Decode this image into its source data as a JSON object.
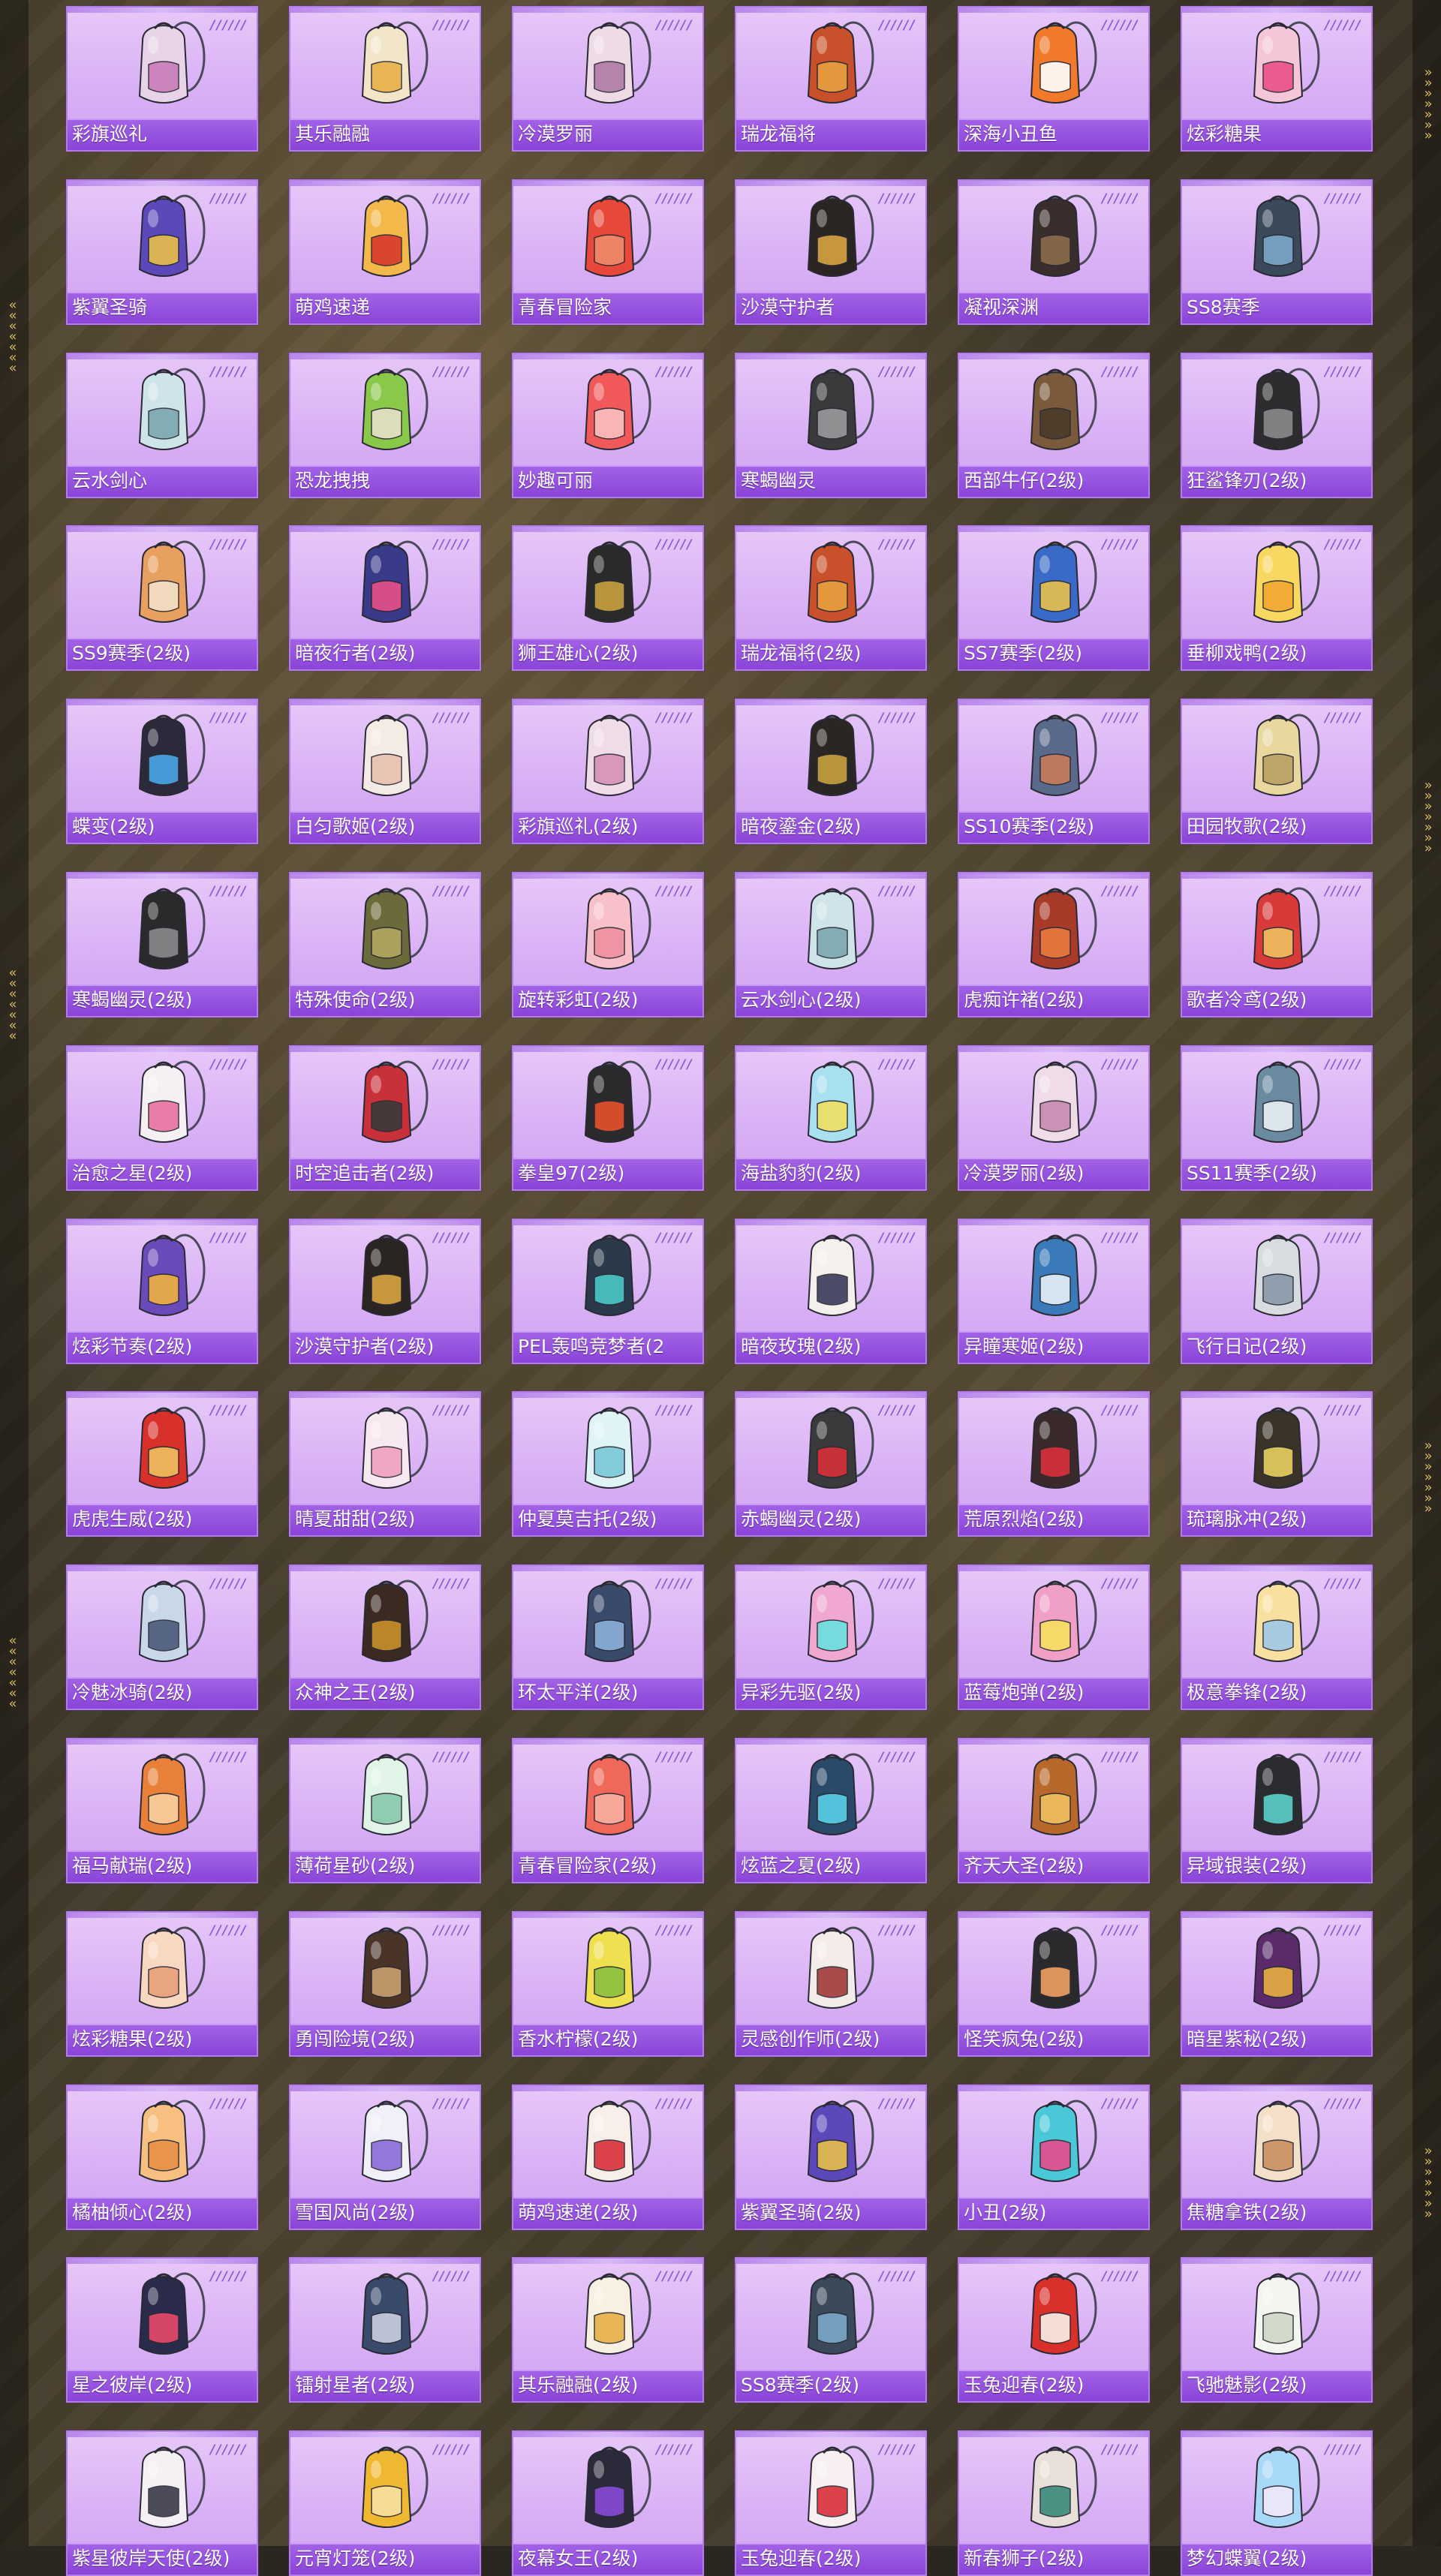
{
  "backpacks": [
    {
      "name": "彩旗巡礼",
      "color": "#e8d4e8",
      "accent": "#c87db8",
      "icon": "backpack-icon"
    },
    {
      "name": "其乐融融",
      "color": "#f3e6c8",
      "accent": "#e8b048",
      "icon": "backpack-icon"
    },
    {
      "name": "冷漠罗丽",
      "color": "#efdbe6",
      "accent": "#b07aa4",
      "icon": "backpack-icon"
    },
    {
      "name": "瑞龙福将",
      "color": "#c8502a",
      "accent": "#e8a040",
      "icon": "backpack-icon"
    },
    {
      "name": "深海小丑鱼",
      "color": "#f07a2a",
      "accent": "#ffffff",
      "icon": "backpack-icon"
    },
    {
      "name": "炫彩糖果",
      "color": "#f4c6d8",
      "accent": "#e8508a",
      "icon": "backpack-icon"
    },
    {
      "name": "紫翼圣骑",
      "color": "#5c48b8",
      "accent": "#e8c04a",
      "icon": "backpack-icon"
    },
    {
      "name": "萌鸡速递",
      "color": "#f2b84a",
      "accent": "#d83a2a",
      "icon": "backpack-icon"
    },
    {
      "name": "青春冒险家",
      "color": "#e8483a",
      "accent": "#f08a6a",
      "icon": "backpack-icon"
    },
    {
      "name": "沙漠守护者",
      "color": "#2a2422",
      "accent": "#d8a440",
      "icon": "backpack-icon"
    },
    {
      "name": "凝视深渊",
      "color": "#3a2e2c",
      "accent": "#8a6a4a",
      "icon": "backpack-icon"
    },
    {
      "name": "SS8赛季",
      "color": "#3a4a5a",
      "accent": "#7aa8c8",
      "icon": "backpack-icon"
    },
    {
      "name": "云水剑心",
      "color": "#cfe4e8",
      "accent": "#7aa8b0",
      "icon": "sword-icon"
    },
    {
      "name": "恐龙拽拽",
      "color": "#8ac84a",
      "accent": "#e8e0c8",
      "icon": "backpack-icon"
    },
    {
      "name": "妙趣可丽",
      "color": "#f0585a",
      "accent": "#f8c0c0",
      "icon": "backpack-icon"
    },
    {
      "name": "寒蝎幽灵",
      "color": "#3a3a3c",
      "accent": "#9a9a9c",
      "icon": "backpack-icon"
    },
    {
      "name": "西部牛仔(2级)",
      "color": "#7a5a3a",
      "accent": "#4a3a2a",
      "icon": "backpack-icon"
    },
    {
      "name": "狂鲨锋刃(2级)",
      "color": "#2e2c2e",
      "accent": "#8a8a8a",
      "icon": "backpack-icon"
    },
    {
      "name": "SS9赛季(2级)",
      "color": "#e8a060",
      "accent": "#f4e0c8",
      "icon": "backpack-icon"
    },
    {
      "name": "暗夜行者(2级)",
      "color": "#3a3a8a",
      "accent": "#e8508a",
      "icon": "backpack-icon"
    },
    {
      "name": "狮王雄心(2级)",
      "color": "#2a2a2a",
      "accent": "#c8a040",
      "icon": "backpack-icon"
    },
    {
      "name": "瑞龙福将(2级)",
      "color": "#c8502a",
      "accent": "#e8a040",
      "icon": "backpack-icon"
    },
    {
      "name": "SS7赛季(2级)",
      "color": "#3a6ac8",
      "accent": "#e8c04a",
      "icon": "backpack-icon"
    },
    {
      "name": "垂柳戏鸭(2级)",
      "color": "#f8d860",
      "accent": "#f0a830",
      "icon": "backpack-icon"
    },
    {
      "name": "蝶变(2级)",
      "color": "#2a2a3a",
      "accent": "#4aa8e8",
      "icon": "butterfly-icon"
    },
    {
      "name": "白匀歌姬(2级)",
      "color": "#f4ece4",
      "accent": "#e8c0b0",
      "icon": "backpack-icon"
    },
    {
      "name": "彩旗巡礼(2级)",
      "color": "#f0dce8",
      "accent": "#d890b8",
      "icon": "backpack-icon"
    },
    {
      "name": "暗夜鎏金(2级)",
      "color": "#2a2624",
      "accent": "#c8a040",
      "icon": "backpack-icon"
    },
    {
      "name": "SS10赛季(2级)",
      "color": "#5a6a8a",
      "accent": "#c87a5a",
      "icon": "backpack-icon"
    },
    {
      "name": "田园牧歌(2级)",
      "color": "#e8d8a0",
      "accent": "#b8a060",
      "icon": "basket-icon"
    },
    {
      "name": "寒蝎幽灵(2级)",
      "color": "#2a2a2c",
      "accent": "#8a8a8c",
      "icon": "backpack-icon"
    },
    {
      "name": "特殊使命(2级)",
      "color": "#6a6a3a",
      "accent": "#b0a860",
      "icon": "backpack-icon"
    },
    {
      "name": "旋转彩虹(2级)",
      "color": "#f8c0c8",
      "accent": "#f090a0",
      "icon": "backpack-icon"
    },
    {
      "name": "云水剑心(2级)",
      "color": "#cfe4e8",
      "accent": "#7aa8b0",
      "icon": "sword-icon"
    },
    {
      "name": "虎痴许褚(2级)",
      "color": "#a83a2a",
      "accent": "#e87a40",
      "icon": "backpack-icon"
    },
    {
      "name": "歌者冷鸢(2级)",
      "color": "#d83a3a",
      "accent": "#f0c060",
      "icon": "backpack-icon"
    },
    {
      "name": "治愈之星(2级)",
      "color": "#f4f0f4",
      "accent": "#e870a0",
      "icon": "backpack-icon"
    },
    {
      "name": "时空追击者(2级)",
      "color": "#c8303a",
      "accent": "#3a3a3a",
      "icon": "backpack-icon"
    },
    {
      "name": "拳皇97(2级)",
      "color": "#2a2a2c",
      "accent": "#e8502a",
      "icon": "backpack-icon"
    },
    {
      "name": "海盐豹豹(2级)",
      "color": "#a8e0f0",
      "accent": "#f0e060",
      "icon": "backpack-icon"
    },
    {
      "name": "冷漠罗丽(2级)",
      "color": "#f0dce8",
      "accent": "#c88ab0",
      "icon": "backpack-icon"
    },
    {
      "name": "SS11赛季(2级)",
      "color": "#6a8aa0",
      "accent": "#e8f0f4",
      "icon": "backpack-icon"
    },
    {
      "name": "炫彩节奏(2级)",
      "color": "#6a4ab8",
      "accent": "#f0b040",
      "icon": "backpack-icon"
    },
    {
      "name": "沙漠守护者(2级)",
      "color": "#2a2422",
      "accent": "#d8a440",
      "icon": "backpack-icon"
    },
    {
      "name": "PEL轰鸣竞梦者(2",
      "color": "#2a3a4a",
      "accent": "#4ac8c8",
      "icon": "backpack-icon"
    },
    {
      "name": "暗夜玫瑰(2级)",
      "color": "#f4f0ec",
      "accent": "#3a3a5a",
      "icon": "rabbit-icon"
    },
    {
      "name": "异瞳寒姬(2级)",
      "color": "#3a7ab8",
      "accent": "#e8f0f8",
      "icon": "backpack-icon"
    },
    {
      "name": "飞行日记(2级)",
      "color": "#d8dce0",
      "accent": "#8a98a8",
      "icon": "backpack-icon"
    },
    {
      "name": "虎虎生威(2级)",
      "color": "#d8302a",
      "accent": "#f0c060",
      "icon": "backpack-icon"
    },
    {
      "name": "晴夏甜甜(2级)",
      "color": "#f8e8f0",
      "accent": "#f0a0c0",
      "icon": "backpack-icon"
    },
    {
      "name": "仲夏莫吉托(2级)",
      "color": "#e0f4f8",
      "accent": "#78c8d8",
      "icon": "backpack-icon"
    },
    {
      "name": "赤蝎幽灵(2级)",
      "color": "#3a3a3c",
      "accent": "#d8303a",
      "icon": "backpack-icon"
    },
    {
      "name": "荒原烈焰(2级)",
      "color": "#3a2a2c",
      "accent": "#d8303a",
      "icon": "backpack-icon"
    },
    {
      "name": "琉璃脉冲(2级)",
      "color": "#3a3428",
      "accent": "#e8d060",
      "icon": "backpack-icon"
    },
    {
      "name": "冷魅冰骑(2级)",
      "color": "#c8d8e8",
      "accent": "#4a5a7a",
      "icon": "backpack-icon"
    },
    {
      "name": "众神之王(2级)",
      "color": "#3a2a22",
      "accent": "#c8902a",
      "icon": "backpack-icon"
    },
    {
      "name": "环太平洋(2级)",
      "color": "#3a4a6a",
      "accent": "#8ab0d8",
      "icon": "backpack-icon"
    },
    {
      "name": "异彩先驱(2级)",
      "color": "#f0a8d0",
      "accent": "#6ae0e0",
      "icon": "backpack-icon"
    },
    {
      "name": "蓝莓炮弹(2级)",
      "color": "#f0a0c8",
      "accent": "#f8e060",
      "icon": "backpack-icon"
    },
    {
      "name": "极意拳锋(2级)",
      "color": "#f8e0a0",
      "accent": "#a0c8e8",
      "icon": "backpack-icon"
    },
    {
      "name": "福马献瑞(2级)",
      "color": "#e8803a",
      "accent": "#f8d0a0",
      "icon": "backpack-icon"
    },
    {
      "name": "薄荷星砂(2级)",
      "color": "#e0f4e8",
      "accent": "#88c8a8",
      "icon": "backpack-icon"
    },
    {
      "name": "青春冒险家(2级)",
      "color": "#f0685a",
      "accent": "#f8b0a0",
      "icon": "backpack-icon"
    },
    {
      "name": "炫蓝之夏(2级)",
      "color": "#2a4a6a",
      "accent": "#5ad0e8",
      "icon": "backpack-icon"
    },
    {
      "name": "齐天大圣(2级)",
      "color": "#b8682a",
      "accent": "#f0c060",
      "icon": "backpack-icon"
    },
    {
      "name": "异域银装(2级)",
      "color": "#2a2c30",
      "accent": "#5ad0c8",
      "icon": "backpack-icon"
    },
    {
      "name": "炫彩糖果(2级)",
      "color": "#f8d8c0",
      "accent": "#e8a07a",
      "icon": "backpack-icon"
    },
    {
      "name": "勇闯险境(2级)",
      "color": "#4a3428",
      "accent": "#c8a070",
      "icon": "barrel-icon"
    },
    {
      "name": "香水柠檬(2级)",
      "color": "#f0e050",
      "accent": "#8ac040",
      "icon": "backpack-icon"
    },
    {
      "name": "灵感创作师(2级)",
      "color": "#f4ece8",
      "accent": "#a03a3a",
      "icon": "backpack-icon"
    },
    {
      "name": "怪笑疯兔(2级)",
      "color": "#2a2a2c",
      "accent": "#f0a060",
      "icon": "backpack-icon"
    },
    {
      "name": "暗星紫秘(2级)",
      "color": "#5a2a6a",
      "accent": "#e8b040",
      "icon": "backpack-icon"
    },
    {
      "name": "橘柚倾心(2级)",
      "color": "#f8c080",
      "accent": "#e89048",
      "icon": "backpack-icon"
    },
    {
      "name": "雪国风尚(2级)",
      "color": "#f0f0f8",
      "accent": "#8a6ad8",
      "icon": "backpack-icon"
    },
    {
      "name": "萌鸡速递(2级)",
      "color": "#f8f0e8",
      "accent": "#d8303a",
      "icon": "backpack-icon"
    },
    {
      "name": "紫翼圣骑(2级)",
      "color": "#5c48b8",
      "accent": "#e8c04a",
      "icon": "backpack-icon"
    },
    {
      "name": "小丑(2级)",
      "color": "#4ac8d8",
      "accent": "#e84a8a",
      "icon": "backpack-icon"
    },
    {
      "name": "焦糖拿铁(2级)",
      "color": "#f4e0c8",
      "accent": "#c89060",
      "icon": "backpack-icon"
    },
    {
      "name": "星之彼岸(2级)",
      "color": "#2a2a4a",
      "accent": "#e84a6a",
      "icon": "backpack-icon"
    },
    {
      "name": "镭射星者(2级)",
      "color": "#3a4a6a",
      "accent": "#c8d0e0",
      "icon": "backpack-icon"
    },
    {
      "name": "其乐融融(2级)",
      "color": "#f8f0e0",
      "accent": "#e8b048",
      "icon": "backpack-icon"
    },
    {
      "name": "SS8赛季(2级)",
      "color": "#3a4a5a",
      "accent": "#7aa8c8",
      "icon": "backpack-icon"
    },
    {
      "name": "玉兔迎春(2级)",
      "color": "#d8302a",
      "accent": "#f8f0e8",
      "icon": "backpack-icon"
    },
    {
      "name": "飞驰魅影(2级)",
      "color": "#f4f4f0",
      "accent": "#d0d8c8",
      "icon": "backpack-icon"
    },
    {
      "name": "紫星彼岸天使(2级)",
      "color": "#f4f0f4",
      "accent": "#3a3a4a",
      "icon": "backpack-icon"
    },
    {
      "name": "元宵灯笼(2级)",
      "color": "#f0b830",
      "accent": "#f8e0a0",
      "icon": "backpack-icon"
    },
    {
      "name": "夜幕女王(2级)",
      "color": "#2a2a3a",
      "accent": "#8a4ad8",
      "icon": "backpack-icon"
    },
    {
      "name": "玉兔迎春(2级)",
      "color": "#f8f0f0",
      "accent": "#d8303a",
      "icon": "rabbit-icon"
    },
    {
      "name": "新春狮子(2级)",
      "color": "#e8e0d8",
      "accent": "#3a8a7a",
      "icon": "backpack-icon"
    },
    {
      "name": "梦幻蝶翼(2级)",
      "color": "#a8d8f8",
      "accent": "#f0e8f8",
      "icon": "butterfly-icon"
    }
  ]
}
